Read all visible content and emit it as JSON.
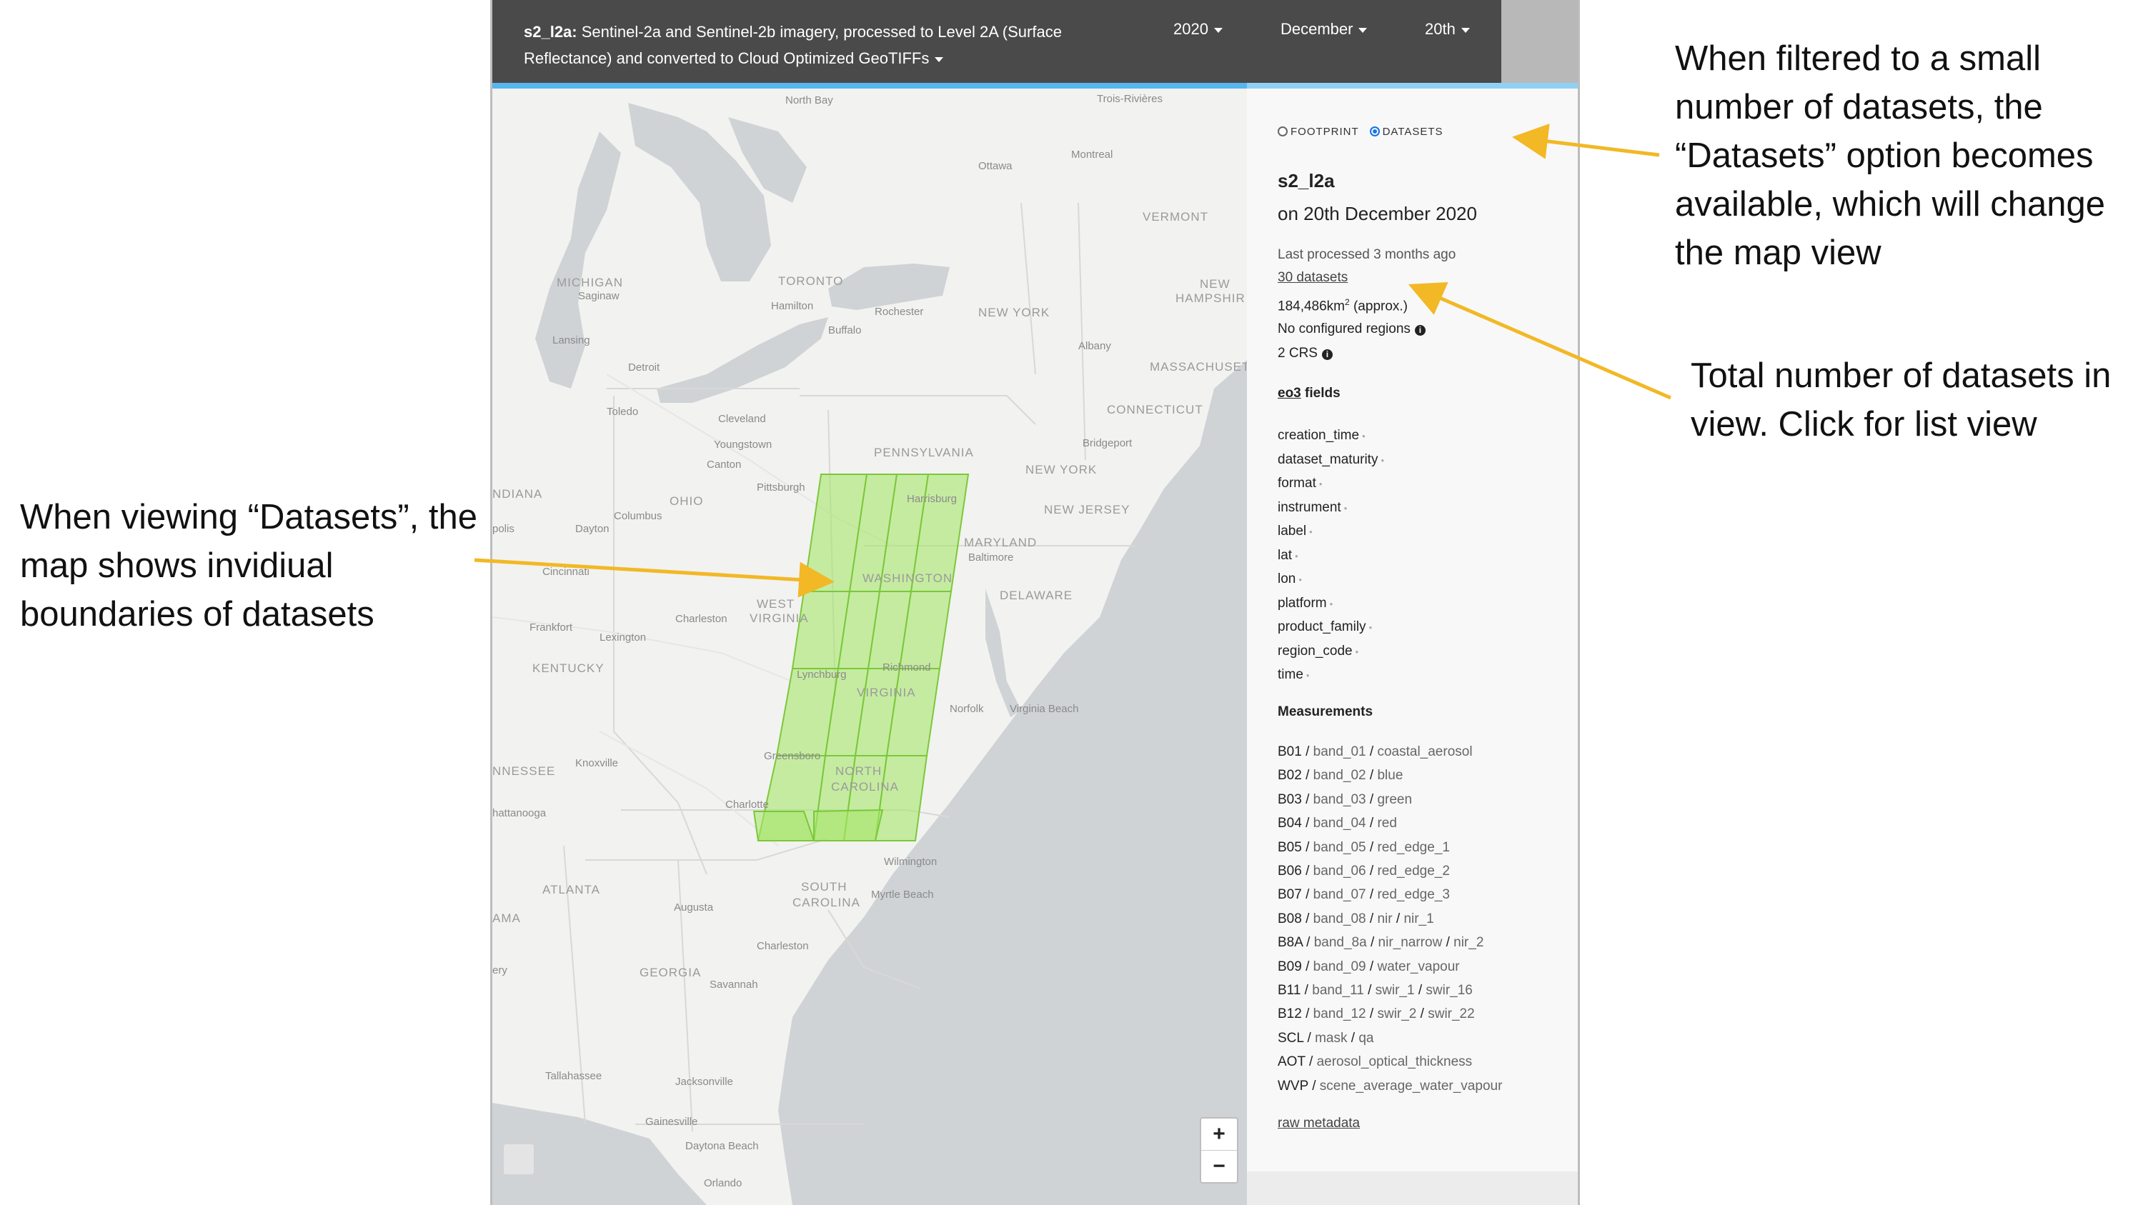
{
  "header": {
    "product_code": "s2_l2a:",
    "product_description": " Sentinel-2a and Sentinel-2b imagery, processed to Level 2A (Surface Reflectance) and converted to Cloud Optimized GeoTIFFs",
    "year": "2020",
    "month": "December",
    "day": "20th"
  },
  "map": {
    "places": [
      "North Bay",
      "Trois-Rivières",
      "Ottawa",
      "Montreal",
      "VERMONT",
      "TORONTO",
      "MICHIGAN",
      "Saginaw",
      "Hamilton",
      "Rochester",
      "NEW YORK",
      "NEW",
      "HAMPSHIR",
      "Buffalo",
      "Lansing",
      "Albany",
      "Detroit",
      "MASSACHUSETT",
      "Toledo",
      "Cleveland",
      "CONNECTICUT",
      "Youngstown",
      "Bridgeport",
      "Canton",
      "PENNSYLVANIA",
      "NEW YORK",
      "Pittsburgh",
      "Harrisburg",
      "NDIANA",
      "OHIO",
      "Columbus",
      "NEW JERSEY",
      "polis",
      "Dayton",
      "MARYLAND",
      "Baltimore",
      "Cincinnati",
      "WASHINGTON",
      "WEST",
      "VIRGINIA",
      "Charleston",
      "DELAWARE",
      "Frankfort",
      "Lexington",
      "KENTUCKY",
      "Lynchburg",
      "Richmond",
      "VIRGINIA",
      "Norfolk",
      "Virginia Beach",
      "Knoxville",
      "NNESSEE",
      "Greensboro",
      "NORTH",
      "CAROLINA",
      "hattanooga",
      "Charlotte",
      "Wilmington",
      "ATLANTA",
      "SOUTH",
      "CAROLINA",
      "Myrtle Beach",
      "Augusta",
      "AMA",
      "Charleston",
      "ery",
      "GEORGIA",
      "Savannah",
      "Tallahassee",
      "Jacksonville",
      "Gainesville",
      "Daytona Beach",
      "Orlando"
    ],
    "zoom_in": "+",
    "zoom_out": "−"
  },
  "panel": {
    "view_footprint": "FOOTPRINT",
    "view_datasets": "DATASETS",
    "selected_view": "datasets",
    "product_name": "s2_l2a",
    "date_text": "on 20th December 2020",
    "last_processed": "Last processed 3 months ago",
    "dataset_count_link": "30 datasets",
    "area": "184,486km",
    "area_sup": "2",
    "area_suffix": " (approx.)",
    "regions": "No configured regions",
    "crs": "2 CRS",
    "fields_heading_link": "eo3",
    "fields_heading_rest": " fields",
    "fields": [
      "creation_time",
      "dataset_maturity",
      "format",
      "instrument",
      "label",
      "lat",
      "lon",
      "platform",
      "product_family",
      "region_code",
      "time"
    ],
    "measurements_heading": "Measurements",
    "measurements": [
      {
        "name": "B01",
        "aliases": [
          "band_01",
          "coastal_aerosol"
        ]
      },
      {
        "name": "B02",
        "aliases": [
          "band_02",
          "blue"
        ]
      },
      {
        "name": "B03",
        "aliases": [
          "band_03",
          "green"
        ]
      },
      {
        "name": "B04",
        "aliases": [
          "band_04",
          "red"
        ]
      },
      {
        "name": "B05",
        "aliases": [
          "band_05",
          "red_edge_1"
        ]
      },
      {
        "name": "B06",
        "aliases": [
          "band_06",
          "red_edge_2"
        ]
      },
      {
        "name": "B07",
        "aliases": [
          "band_07",
          "red_edge_3"
        ]
      },
      {
        "name": "B08",
        "aliases": [
          "band_08",
          "nir",
          "nir_1"
        ]
      },
      {
        "name": "B8A",
        "aliases": [
          "band_8a",
          "nir_narrow",
          "nir_2"
        ]
      },
      {
        "name": "B09",
        "aliases": [
          "band_09",
          "water_vapour"
        ]
      },
      {
        "name": "B11",
        "aliases": [
          "band_11",
          "swir_1",
          "swir_16"
        ]
      },
      {
        "name": "B12",
        "aliases": [
          "band_12",
          "swir_2",
          "swir_22"
        ]
      },
      {
        "name": "SCL",
        "aliases": [
          "mask",
          "qa"
        ]
      },
      {
        "name": "AOT",
        "aliases": [
          "aerosol_optical_thickness"
        ]
      },
      {
        "name": "WVP",
        "aliases": [
          "scene_average_water_vapour"
        ]
      }
    ],
    "raw_metadata": "raw metadata"
  },
  "annotations": {
    "datasets_option": "When filtered to a small number of datasets, the “Datasets” option becomes available, which will change the map view",
    "total_datasets": "Total number of datasets in view. Click for list view",
    "dataset_boundaries": "When viewing “Datasets”, the map shows invidiual boundaries of datasets"
  },
  "colors": {
    "header_bg": "#4a4a4a",
    "accent": "#57b6f0",
    "footprint_fill": "#9be25a",
    "arrow": "#f2b825",
    "radio_selected": "#1a73e8"
  }
}
